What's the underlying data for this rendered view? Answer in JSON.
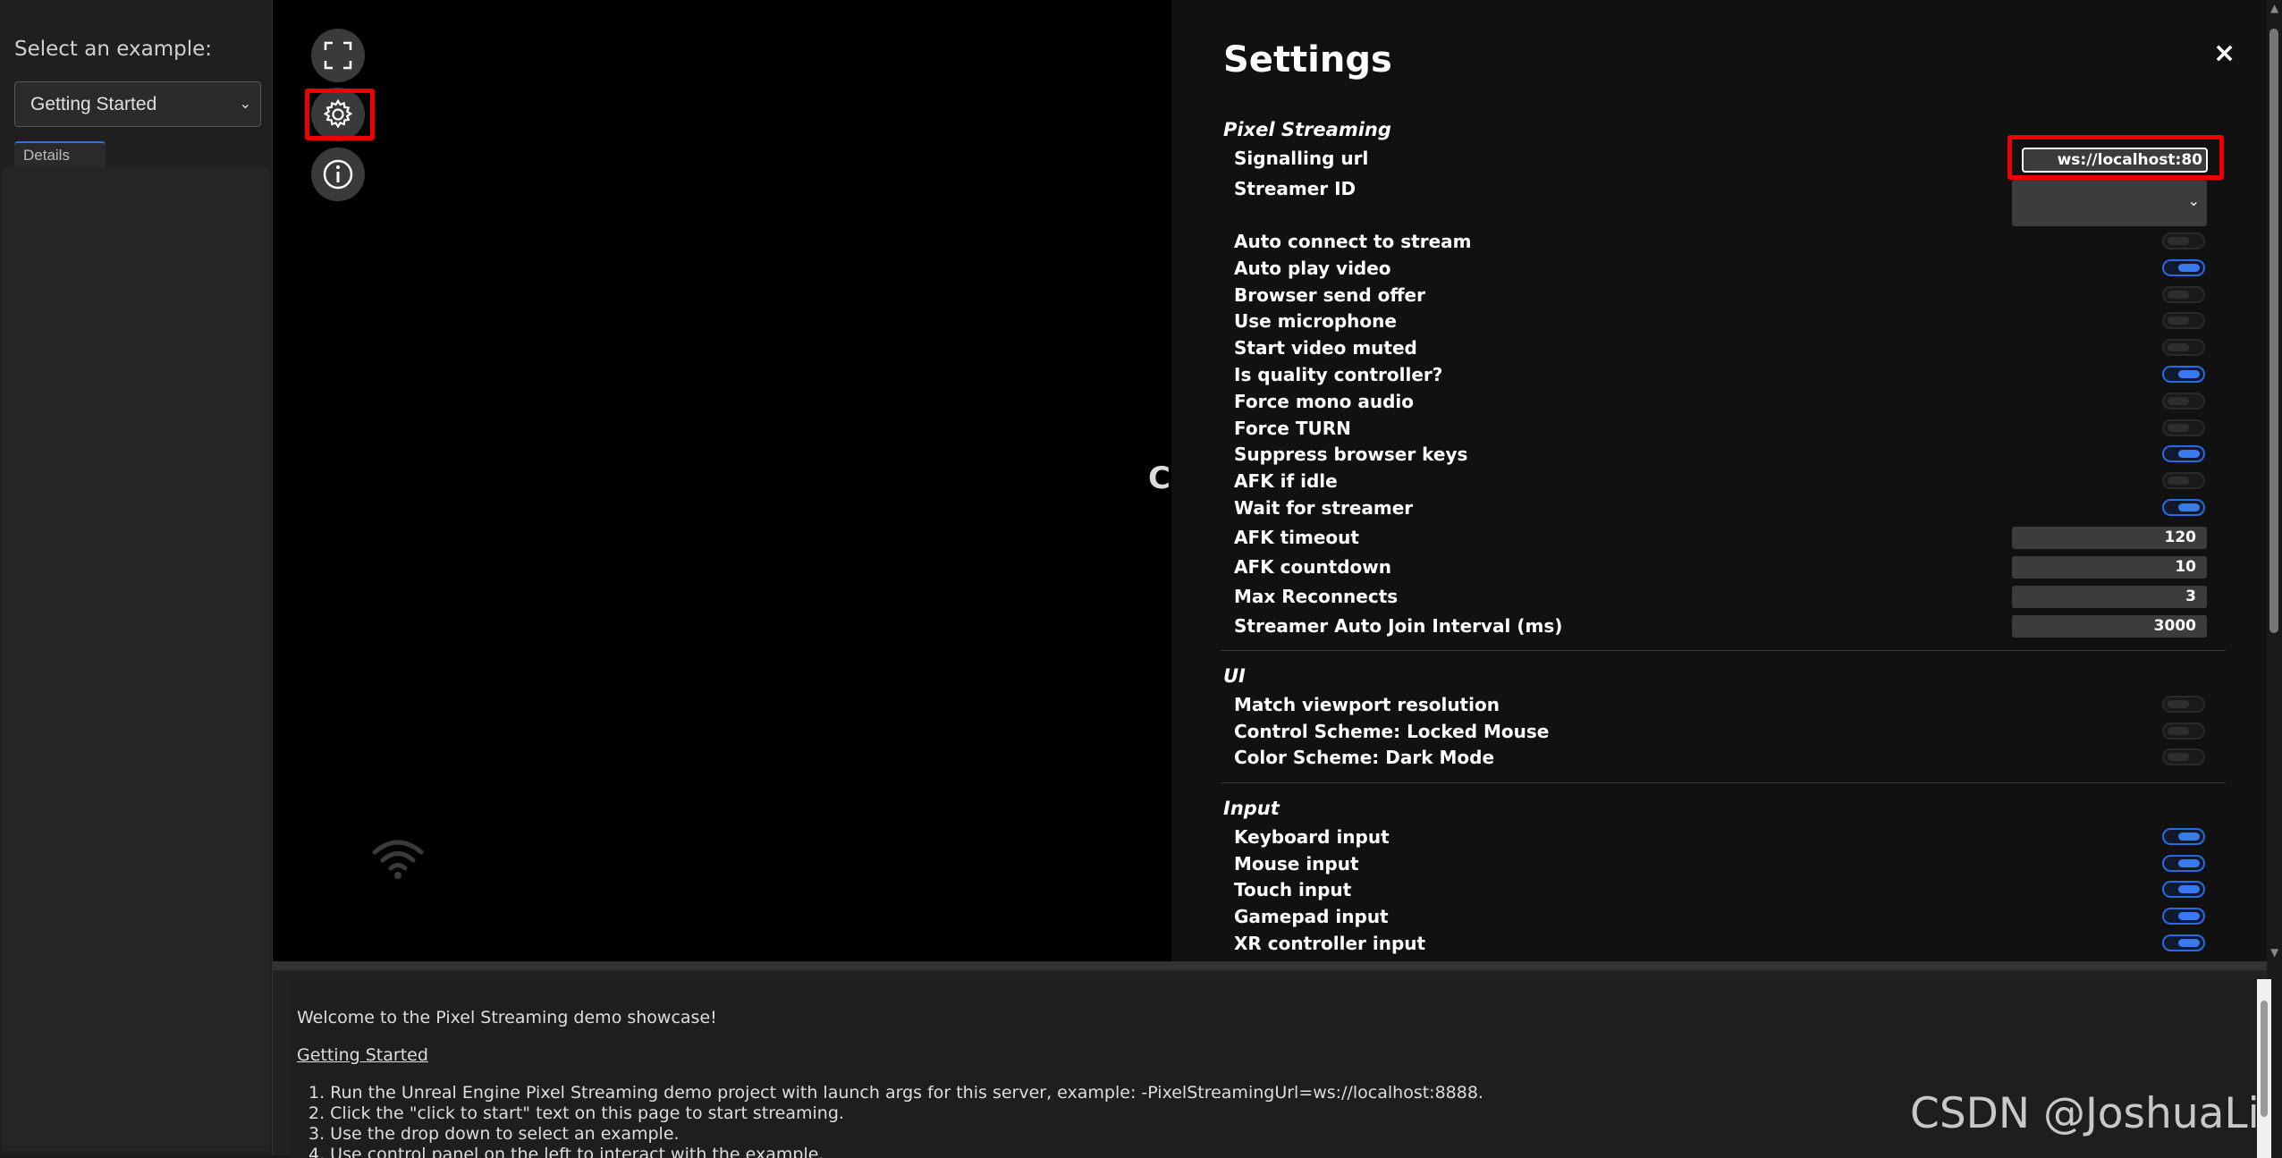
{
  "sidebar": {
    "select_label": "Select an example:",
    "selected_example": "Getting Started",
    "details_tab": "Details"
  },
  "viewer": {
    "click_to_start_visible": "C",
    "controls": [
      "fullscreen-icon",
      "gear-icon",
      "info-icon"
    ],
    "status_icon": "wifi-icon"
  },
  "settings": {
    "title": "Settings",
    "close": "×",
    "sections": {
      "pixel_streaming": "Pixel Streaming",
      "ui": "UI",
      "input": "Input"
    },
    "signalling_url_label": "Signalling url",
    "signalling_url_value": "ws://localhost:80",
    "streamer_id_label": "Streamer ID",
    "streamer_id_value": "",
    "toggles": [
      {
        "label": "Auto connect to stream",
        "on": false
      },
      {
        "label": "Auto play video",
        "on": true
      },
      {
        "label": "Browser send offer",
        "on": false
      },
      {
        "label": "Use microphone",
        "on": false
      },
      {
        "label": "Start video muted",
        "on": false
      },
      {
        "label": "Is quality controller?",
        "on": true
      },
      {
        "label": "Force mono audio",
        "on": false
      },
      {
        "label": "Force TURN",
        "on": false
      },
      {
        "label": "Suppress browser keys",
        "on": true
      },
      {
        "label": "AFK if idle",
        "on": false
      },
      {
        "label": "Wait for streamer",
        "on": true
      }
    ],
    "numbers": [
      {
        "label": "AFK timeout",
        "value": "120"
      },
      {
        "label": "AFK countdown",
        "value": "10"
      },
      {
        "label": "Max Reconnects",
        "value": "3"
      },
      {
        "label": "Streamer Auto Join Interval (ms)",
        "value": "3000"
      }
    ],
    "ui_toggles": [
      {
        "label": "Match viewport resolution",
        "on": false
      },
      {
        "label": "Control Scheme: Locked Mouse",
        "on": false
      },
      {
        "label": "Color Scheme: Dark Mode",
        "on": false
      }
    ],
    "input_toggles": [
      {
        "label": "Keyboard input",
        "on": true
      },
      {
        "label": "Mouse input",
        "on": true
      },
      {
        "label": "Touch input",
        "on": true
      },
      {
        "label": "Gamepad input",
        "on": true
      },
      {
        "label": "XR controller input",
        "on": true
      }
    ]
  },
  "bottom": {
    "welcome": "Welcome to the Pixel Streaming demo showcase!",
    "link": "Getting Started",
    "steps": [
      "1. Run the Unreal Engine Pixel Streaming demo project with launch args for this server, example: -PixelStreamingUrl=ws://localhost:8888.",
      "2. Click the \"click to start\" text on this page to start streaming.",
      "3. Use the drop down to select an example.",
      "4. Use control panel on the left to interact with the example."
    ]
  },
  "watermark": "CSDN @JoshuaLi",
  "colors": {
    "accent_blue": "#3a7af0",
    "highlight_red": "#e00000"
  }
}
